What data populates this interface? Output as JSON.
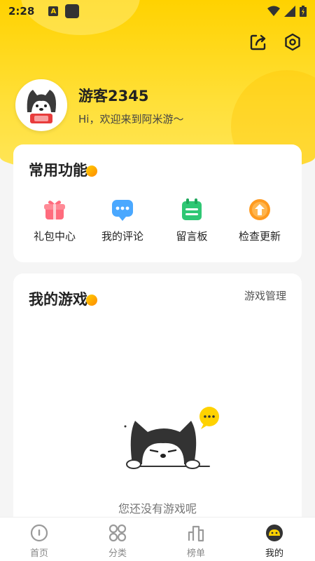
{
  "status_bar": {
    "time": "2:28",
    "notif_icon": "a-icon"
  },
  "header": {
    "username": "游客2345",
    "welcome": "Hi，欢迎来到阿米游～",
    "accent_color": "#ffd200"
  },
  "features": {
    "title": "常用功能",
    "items": [
      {
        "label": "礼包中心",
        "icon": "gift-icon"
      },
      {
        "label": "我的评论",
        "icon": "comment-icon"
      },
      {
        "label": "留言板",
        "icon": "message-board-icon"
      },
      {
        "label": "检查更新",
        "icon": "update-icon"
      }
    ]
  },
  "games": {
    "title": "我的游戏",
    "manage_label": "游戏管理",
    "empty_text": "您还没有游戏呢"
  },
  "tabbar": {
    "items": [
      {
        "label": "首页",
        "icon": "home-icon",
        "active": false
      },
      {
        "label": "分类",
        "icon": "category-icon",
        "active": false
      },
      {
        "label": "榜单",
        "icon": "ranking-icon",
        "active": false
      },
      {
        "label": "我的",
        "icon": "mine-icon",
        "active": true
      }
    ]
  }
}
